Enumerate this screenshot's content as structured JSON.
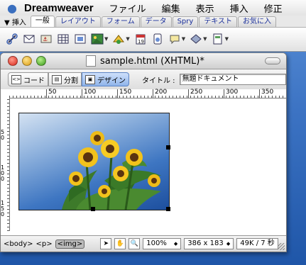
{
  "menubar": {
    "app_name": "Dreamweaver",
    "items": [
      "ファイル",
      "編集",
      "表示",
      "挿入",
      "修正"
    ]
  },
  "insertbar": {
    "title": "▼ 挿入",
    "tabs": [
      "一般",
      "レイアウト",
      "フォーム",
      "データ",
      "Spry",
      "テキスト",
      "お気に入"
    ],
    "active_tab": "一般"
  },
  "document": {
    "title": "sample.html (XHTML)*",
    "view_buttons": {
      "code": "コード",
      "split": "分割",
      "design": "デザイン"
    },
    "title_label": "タイトル :",
    "title_value": "無題ドキュメント"
  },
  "ruler": {
    "top_labels": [
      "50",
      "100",
      "150",
      "200",
      "250",
      "300",
      "350"
    ],
    "left_labels": [
      "50",
      "100",
      "150"
    ]
  },
  "statusbar": {
    "tags": [
      "<body>",
      "<p>",
      "<img>"
    ],
    "selected_tag": "<img>",
    "zoom": "100%",
    "window_size": "386 x 183",
    "download": "49K / 7 秒"
  },
  "colors": {
    "desktop": "#3d74c4",
    "sky": "#3e76c2",
    "active_view": "#8fb4ea"
  }
}
